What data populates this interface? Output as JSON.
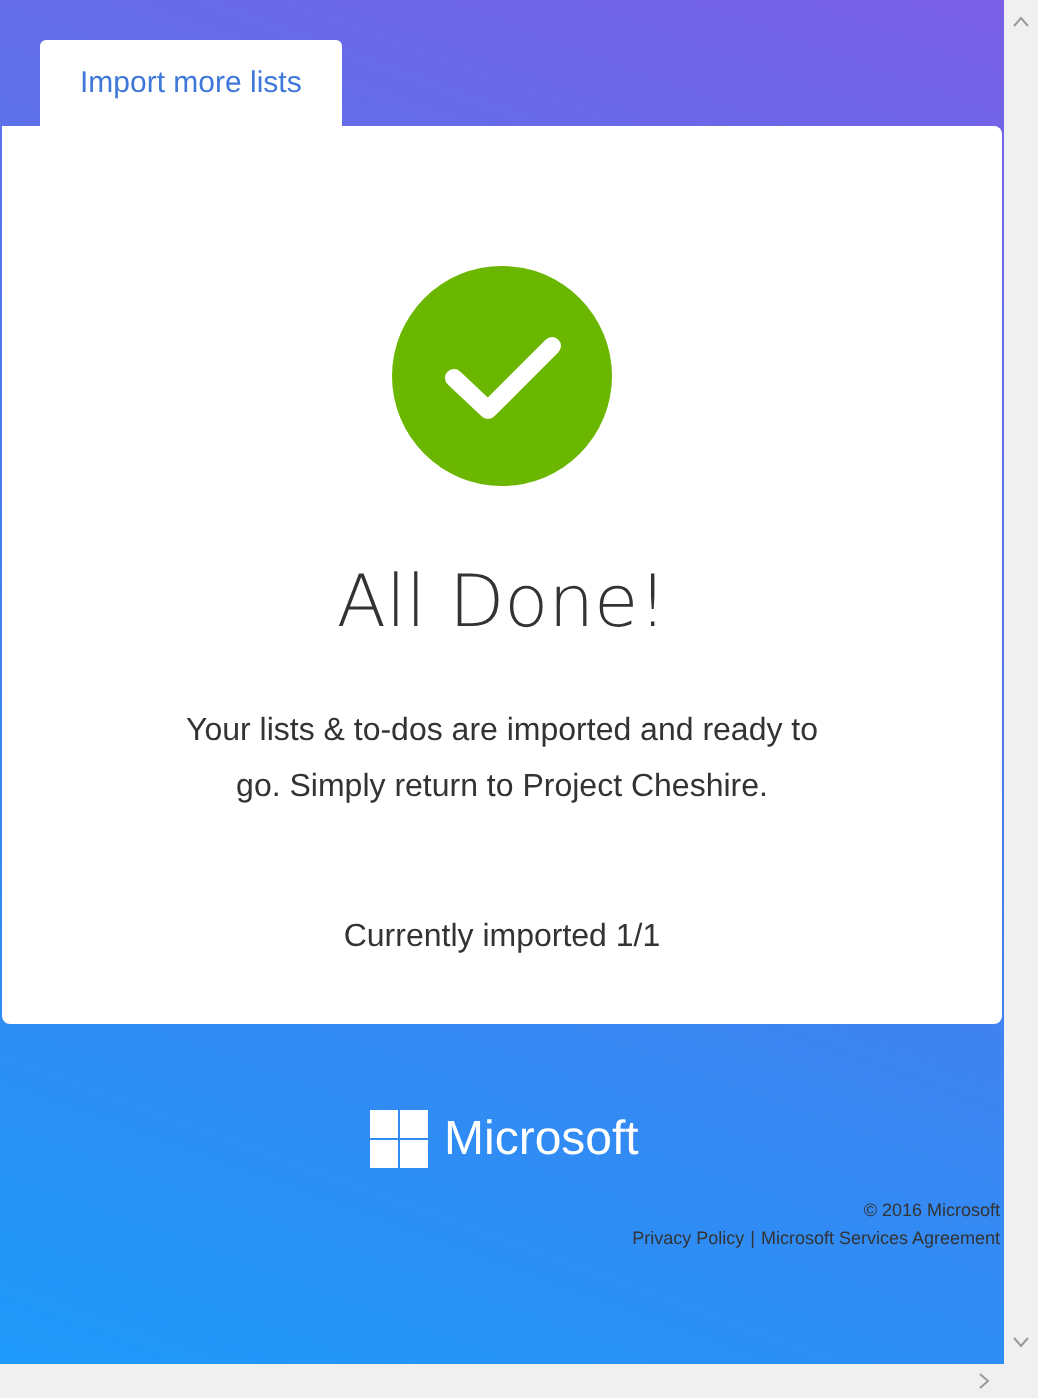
{
  "tabs": [
    {
      "label": "Import more lists",
      "selected": true
    }
  ],
  "card": {
    "title": "All Done!",
    "message": "Your lists & to-dos are imported and ready to go. Simply return to Project Cheshire.",
    "status": "Currently imported 1/1"
  },
  "footer": {
    "brand": "Microsoft",
    "copyright": "© 2016 Microsoft",
    "links": [
      "Privacy Policy",
      "Microsoft Services Agreement"
    ],
    "separator": "|"
  }
}
